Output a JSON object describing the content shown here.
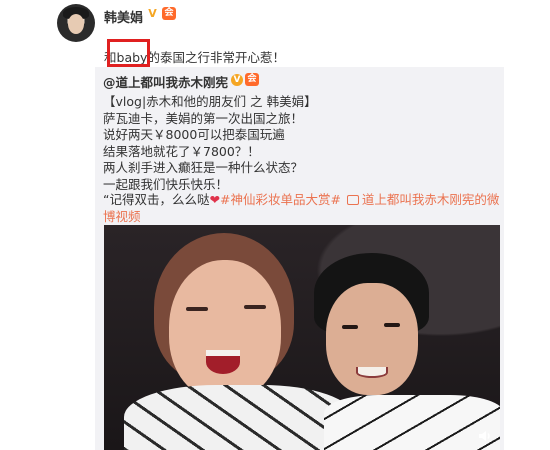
{
  "author": {
    "name": "韩美娟",
    "vip_badge": "V",
    "member_badge": "会"
  },
  "post": {
    "text_before": "和",
    "highlight": "baby",
    "text_after": "的泰国之行非常开心惹！"
  },
  "repost": {
    "author": "@道上都叫我赤木刚宪",
    "vip_badge": "V",
    "member_badge": "会",
    "lines": [
      "【vlog|赤木和他的朋友们 之 韩美娟】",
      "萨瓦迪卡，美娟的第一次出国之旅！",
      "说好两天￥8000可以把泰国玩遍",
      "结果落地就花了￥7800？！",
      "两人刹手进入癫狂是一种什么状态？",
      "一起跟我们快乐快乐！"
    ],
    "last_line_text": "“记得双击，么么哒",
    "heart": "❤",
    "topic": "#神仙彩妆单品大赏#",
    "video_link": "道上都叫我赤木刚宪的微博视频"
  },
  "icons": {
    "avatar": "avatar",
    "link": "video-link-icon",
    "volume": "volume-icon"
  },
  "colors": {
    "link": "#eb7350",
    "highlight_border": "#e02020",
    "member_badge": "#ff6a2b",
    "vip": "#f5a623"
  }
}
